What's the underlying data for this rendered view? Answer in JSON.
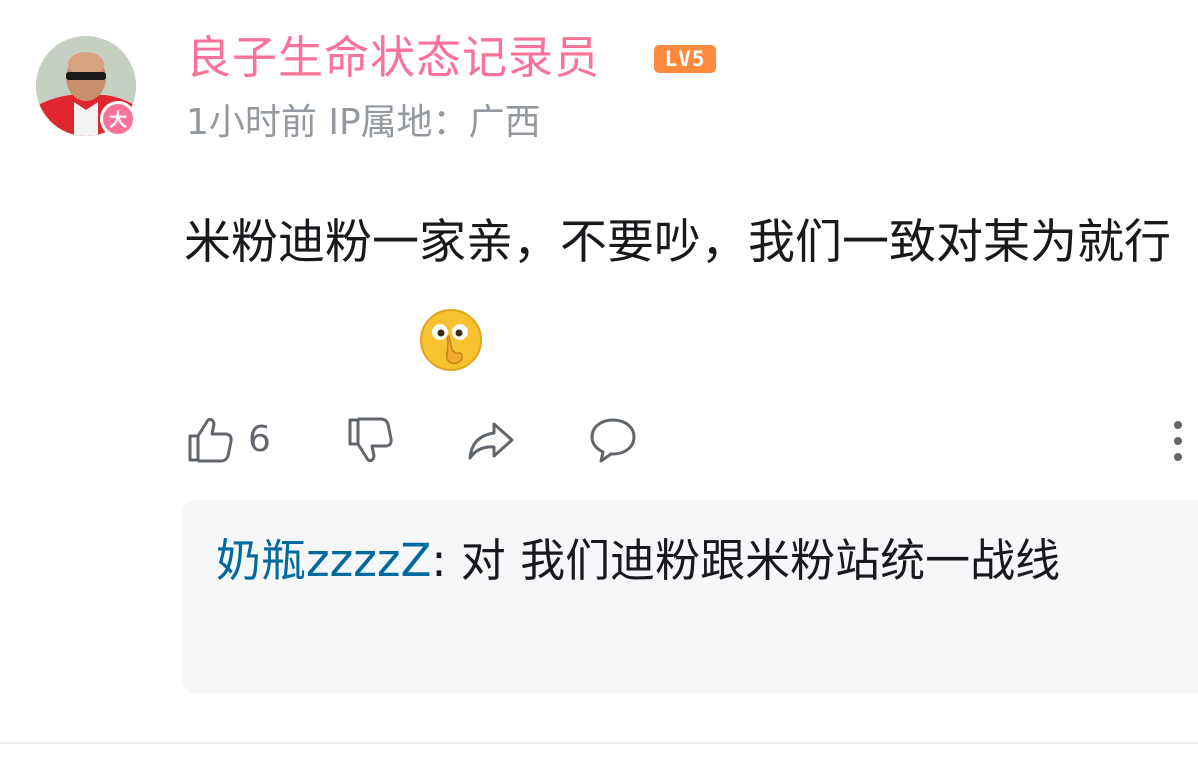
{
  "comment": {
    "username": "良子生命状态记录员",
    "level_badge": "LV5",
    "avatar_badge": "大",
    "meta": "1小时前 IP属地：广西",
    "text": "米粉迪粉一家亲，不要吵，我们一致对某为就行",
    "emoji": "shushing-face-emoji"
  },
  "actions": {
    "like_count": "6",
    "like_icon": "thumbs-up-icon",
    "dislike_icon": "thumbs-down-icon",
    "share_icon": "share-icon",
    "reply_icon": "comment-icon",
    "more_icon": "more-vertical-icon"
  },
  "reply": {
    "user": "奶瓶zzzzZ",
    "separator": ": ",
    "text": "对 我们迪粉跟米粉站统一战线"
  },
  "colors": {
    "username": "#fb7299",
    "level_badge": "#ff8a3d",
    "meta": "#9499a0",
    "reply_user": "#00699d",
    "reply_bg": "#f6f7f8"
  }
}
